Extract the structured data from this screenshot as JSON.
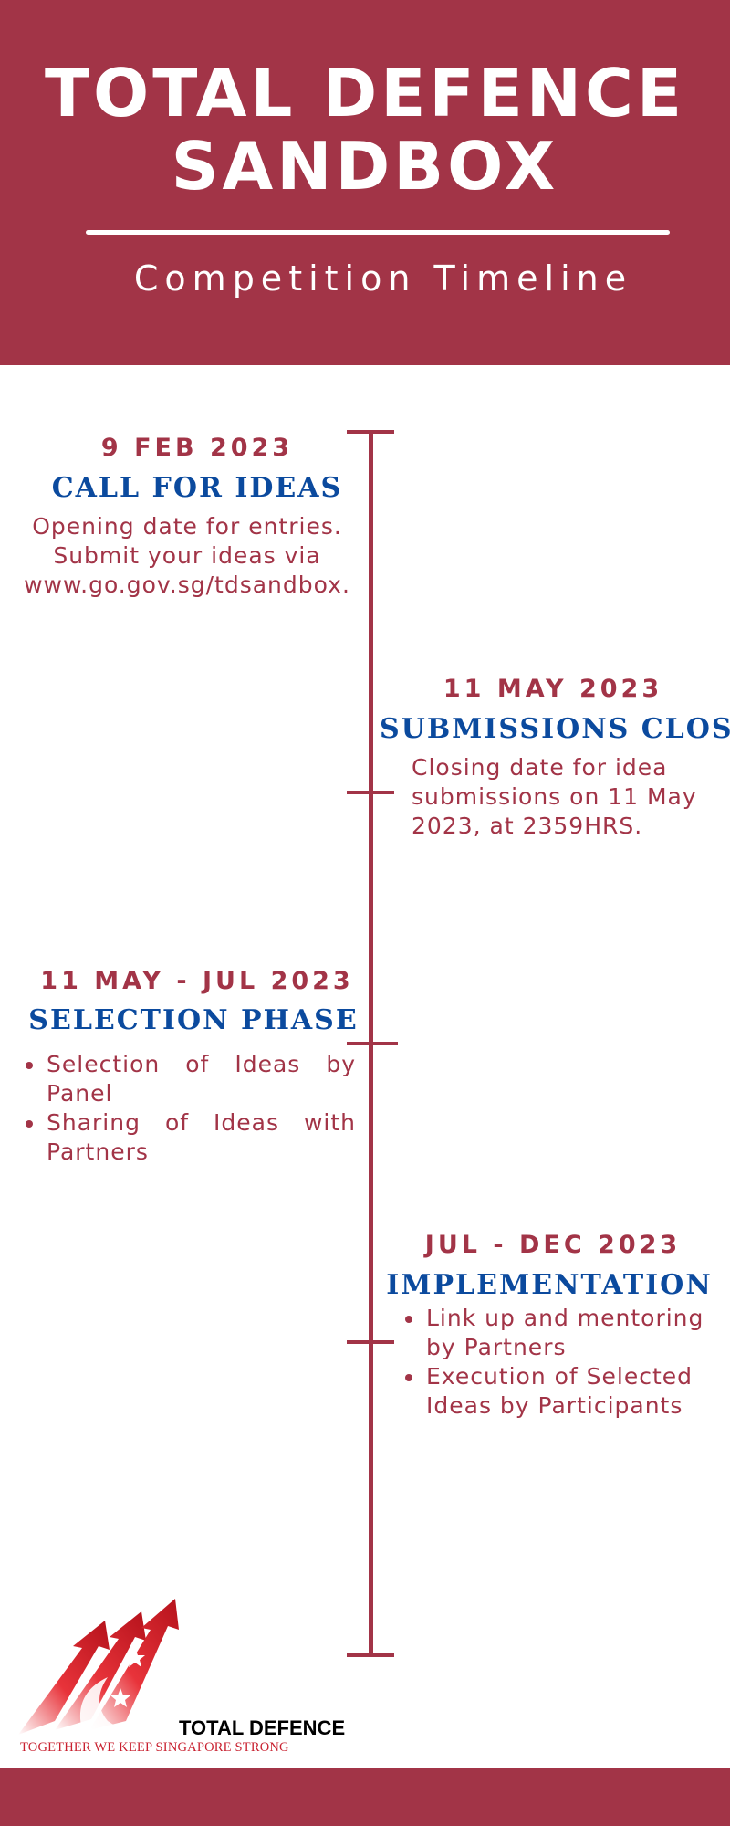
{
  "header": {
    "title_line1": "TOTAL DEFENCE",
    "title_line2": "SANDBOX",
    "subtitle": "Competition Timeline"
  },
  "timeline": [
    {
      "date": "9 FEB 2023",
      "event": "CALL FOR IDEAS",
      "desc_lines": [
        "Opening date for entries.",
        "Submit your ideas via",
        "www.go.gov.sg/tdsandbox."
      ]
    },
    {
      "date": "11 MAY 2023",
      "event": "SUBMISSIONS CLOSE",
      "desc_lines": [
        "Closing date for idea",
        "submissions on 11 May",
        "2023, at 2359HRS."
      ]
    },
    {
      "date": "11 MAY - JUL 2023",
      "event": "SELECTION PHASE",
      "bullets": [
        "Selection of Ideas by Panel",
        "Sharing of Ideas with Partners"
      ]
    },
    {
      "date": "JUL - DEC 2023",
      "event": "IMPLEMENTATION",
      "bullets": [
        "Link up and mentoring by Partners",
        "Execution of Selected Ideas by Participants"
      ]
    }
  ],
  "logo": {
    "name": "TOTAL DEFENCE",
    "tagline": "TOGETHER WE KEEP SINGAPORE STRONG"
  },
  "colors": {
    "primary": "#a23447",
    "heading_blue": "#0b4a9e",
    "background": "#ffffff"
  }
}
